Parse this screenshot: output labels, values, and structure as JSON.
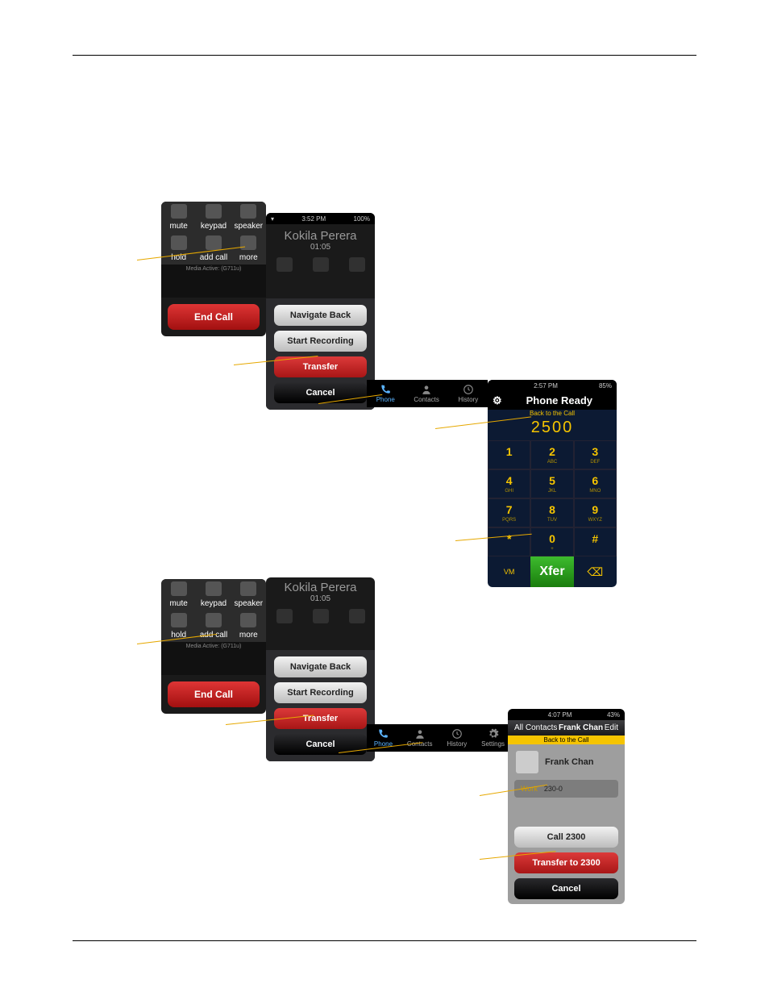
{
  "callscreen": {
    "mute": "mute",
    "keypad": "keypad",
    "speaker": "speaker",
    "hold": "hold",
    "addcall": "add call",
    "more": "more",
    "media": "Media Active: (G711u)",
    "endcall": "End Call"
  },
  "moremenu": {
    "name": "Kokila Perera",
    "time": "01:05",
    "status_time": "3:52 PM",
    "status_batt": "100%",
    "nav_back": "Navigate Back",
    "start_rec": "Start Recording",
    "transfer": "Transfer",
    "cancel": "Cancel"
  },
  "tabs": {
    "phone": "Phone",
    "contacts": "Contacts",
    "history": "History",
    "settings": "Settings"
  },
  "dialer": {
    "status_time": "2:57 PM",
    "status_batt": "85%",
    "ready": "Phone Ready",
    "back_to_call": "Back to the Call",
    "number": "2500",
    "keys": [
      {
        "d": "1",
        "s": ""
      },
      {
        "d": "2",
        "s": "ABC"
      },
      {
        "d": "3",
        "s": "DEF"
      },
      {
        "d": "4",
        "s": "GHI"
      },
      {
        "d": "5",
        "s": "JKL"
      },
      {
        "d": "6",
        "s": "MNO"
      },
      {
        "d": "7",
        "s": "PQRS"
      },
      {
        "d": "8",
        "s": "TUV"
      },
      {
        "d": "9",
        "s": "WXYZ"
      },
      {
        "d": "*",
        "s": ""
      },
      {
        "d": "0",
        "s": "+"
      },
      {
        "d": "#",
        "s": ""
      }
    ],
    "vm": "VM",
    "xfer": "Xfer",
    "del": "⌫"
  },
  "contact": {
    "status_time": "4:07 PM",
    "status_batt": "43%",
    "all": "All Contacts",
    "name": "Frank Chan",
    "edit": "Edit",
    "back_to_call": "Back to the Call",
    "row_name": "Frank Chan",
    "phone_label": "Work",
    "phone_num": "230-0",
    "call": "Call 2300",
    "transfer": "Transfer to 2300",
    "cancel": "Cancel"
  }
}
